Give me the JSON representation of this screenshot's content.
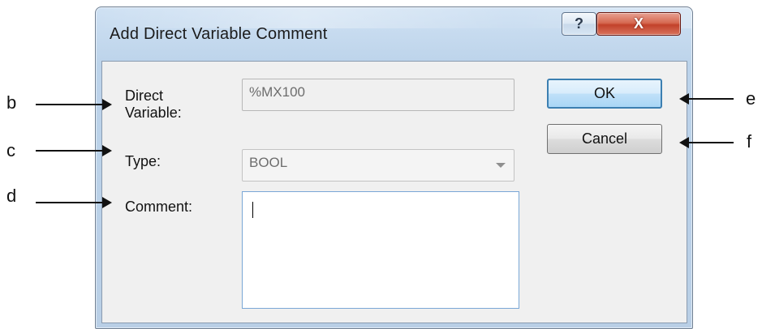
{
  "dialog": {
    "title": "Add Direct Variable Comment",
    "help_button": "?",
    "close_button": "X",
    "labels": {
      "direct_variable": "Direct Variable:",
      "type": "Type:",
      "comment": "Comment:"
    },
    "fields": {
      "direct_variable": "%MX100",
      "type": "BOOL",
      "comment": ""
    },
    "buttons": {
      "ok": "OK",
      "cancel": "Cancel"
    }
  },
  "annotations": {
    "b": "b",
    "c": "c",
    "d": "d",
    "e": "e",
    "f": "f"
  },
  "colors": {
    "frame": "#bcd3ea",
    "client": "#f0f0f0",
    "close_button": "#c2412a",
    "focus_border": "#3c7fb1"
  }
}
